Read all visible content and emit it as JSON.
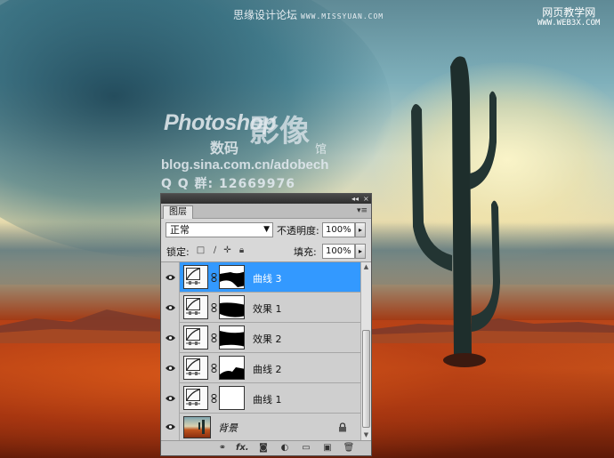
{
  "watermarks": {
    "top_title": "思缘设计论坛",
    "top_site": "WWW.MISSYUAN.COM",
    "right_line1": "网页教学网",
    "right_line2": "WWW.WEB3X.COM",
    "logo_ps": "Photoshop",
    "logo_yingxiang": "影像",
    "logo_shuma": "数码",
    "logo_guan": "馆",
    "blog_url": "blog.sina.com.cn/adobech",
    "qq_group": "Q Q 群: 12669976"
  },
  "panel": {
    "tab_label": "图层",
    "collapse_icon": "◂◂",
    "close_icon": "×",
    "menu_icon": "▾≡",
    "blend_mode": "正常",
    "opacity_label": "不透明度:",
    "opacity_value": "100%",
    "lock_label": "锁定:",
    "fill_label": "填充:",
    "fill_value": "100%",
    "layers": [
      {
        "name": "曲线 3",
        "type": "curves",
        "selected": true,
        "mask": "mask-a"
      },
      {
        "name": "效果 1",
        "type": "curves",
        "selected": false,
        "mask": "mask-b"
      },
      {
        "name": "效果 2",
        "type": "curves",
        "selected": false,
        "mask": "mask-c"
      },
      {
        "name": "曲线 2",
        "type": "curves",
        "selected": false,
        "mask": "mask-d"
      },
      {
        "name": "曲线 1",
        "type": "curves",
        "selected": false,
        "mask": "mask-white"
      },
      {
        "name": "背景",
        "type": "background",
        "selected": false,
        "locked": true
      }
    ],
    "toolbar": [
      "link-layers-icon",
      "fx-icon",
      "add-mask-icon",
      "adjustment-layer-icon",
      "new-group-icon",
      "new-layer-icon",
      "trash-icon"
    ],
    "toolbar_fx_label": "fx."
  },
  "colors": {
    "selected_layer": "#3399ff",
    "panel_bg": "#d8d8d8"
  }
}
